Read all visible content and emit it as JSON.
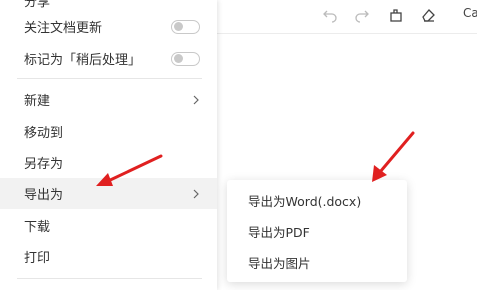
{
  "menu": {
    "top_partial_label": "分享",
    "follow_updates_label": "关注文档更新",
    "mark_label": "标记为「稍后处理」",
    "new_label": "新建",
    "move_label": "移动到",
    "save_as_label": "另存为",
    "export_label": "导出为",
    "download_label": "下载",
    "print_label": "打印"
  },
  "submenu": {
    "word_label": "导出为Word(.docx)",
    "pdf_label": "导出为PDF",
    "image_label": "导出为图片"
  },
  "toolbar": {
    "font_label": "Calibri"
  },
  "toggles": {
    "follow_updates_on": false,
    "mark_on": false
  },
  "colors": {
    "annotation_arrow": "#e02020"
  }
}
